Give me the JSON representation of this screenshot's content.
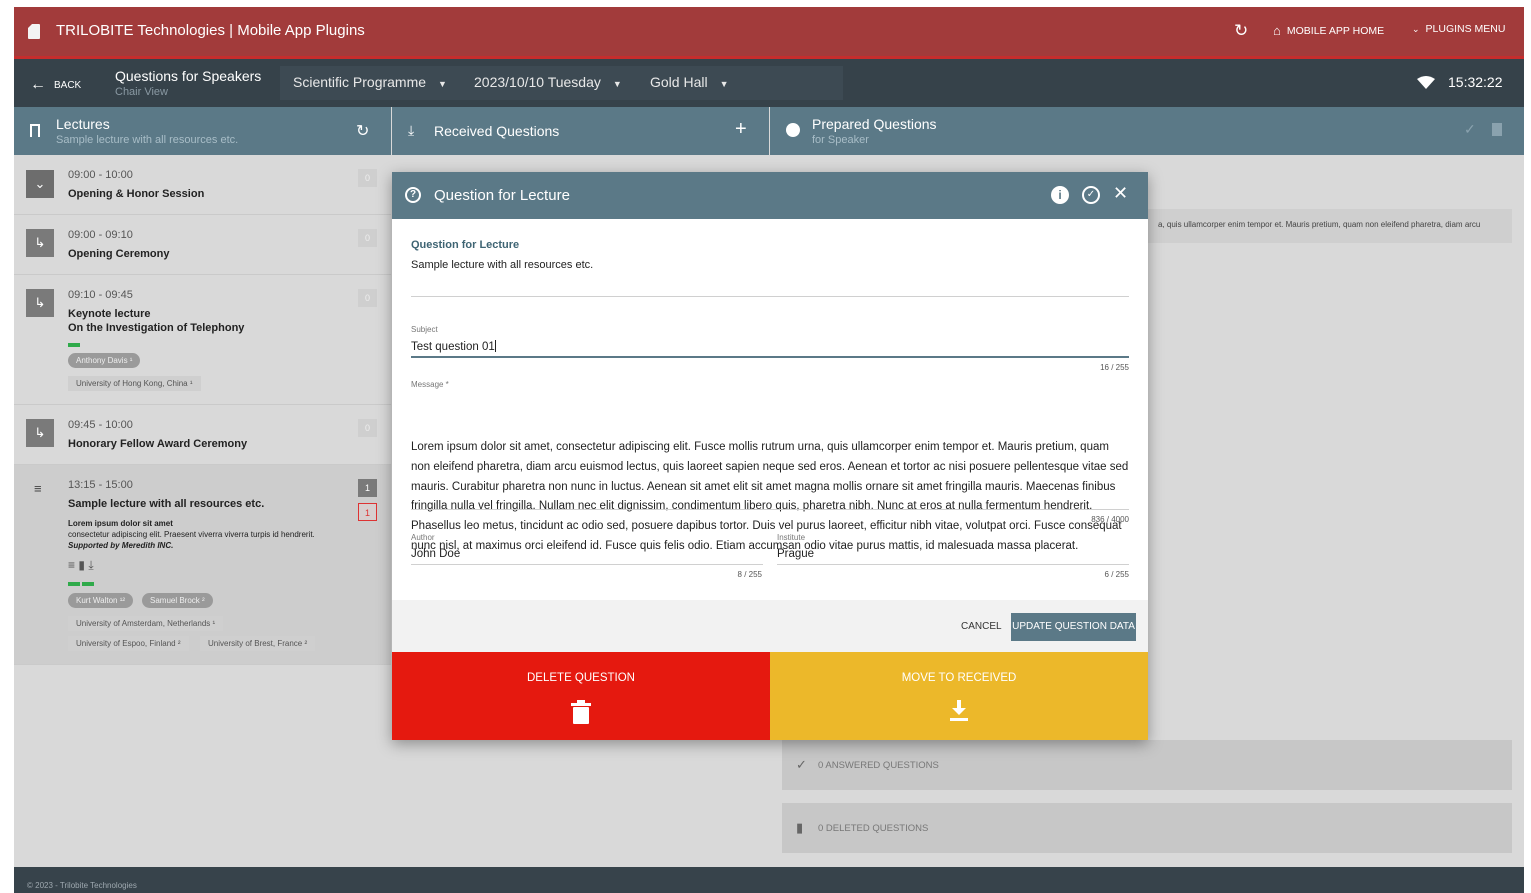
{
  "topbar": {
    "title": "TRILOBITE Technologies | Mobile App Plugins",
    "home": "MOBILE APP HOME",
    "plugins": "PLUGINS MENU"
  },
  "navbar": {
    "back": "BACK",
    "title": "Questions for Speakers",
    "subtitle": "Chair View",
    "programme": "Scientific Programme",
    "date": "2023/10/10 Tuesday",
    "hall": "Gold Hall",
    "time": "15:32:22"
  },
  "colA": {
    "title": "Lectures",
    "subtitle": "Sample lecture with all resources etc."
  },
  "colB": {
    "title": "Received Questions"
  },
  "colC": {
    "title": "Prepared Questions",
    "subtitle": "for Speaker",
    "snippet": "a, quis ullamcorper enim tempor et. Mauris pretium, quam non eleifend pharetra, diam arcu"
  },
  "lectures": [
    {
      "time": "09:00 - 10:00",
      "name": "Opening & Honor Session",
      "count": "0"
    },
    {
      "time": "09:00 - 09:10",
      "name": "Opening Ceremony",
      "count": "0"
    },
    {
      "time": "09:10 - 09:45",
      "name": "Keynote lecture",
      "name2": "On the Investigation of Telephony",
      "count": "0",
      "chip": "Anthony Davis ¹",
      "tag": "University of Hong Kong, China ¹"
    },
    {
      "time": "09:45 - 10:00",
      "name": "Honorary Fellow Award Ceremony",
      "count": "0"
    },
    {
      "time": "13:15 - 15:00",
      "name": "Sample lecture with all resources etc.",
      "count": "1",
      "count2": "1",
      "abstract1": "Lorem ipsum dolor sit amet",
      "abstract2": "consectetur adipiscing elit. Praesent viverra viverra turpis id hendrerit.",
      "abstract3": "Supported by Meredith INC.",
      "chips": [
        "Kurt Walton ¹²",
        "Samuel Brock ²"
      ],
      "tags": [
        "University of Amsterdam, Netherlands ¹",
        "University of Espoo, Finland ²",
        "University of Brest, France ²"
      ]
    }
  ],
  "answered": "0 ANSWERED QUESTIONS",
  "deleted": "0 DELETED QUESTIONS",
  "footer": "© 2023 - Trilobite Technologies",
  "modal": {
    "title": "Question for Lecture",
    "section_title": "Question for Lecture",
    "section_sub": "Sample lecture with all resources etc.",
    "subject_label": "Subject",
    "subject_value": "Test question 01",
    "subject_count": "16 / 255",
    "message_label": "Message *",
    "message_value": "Lorem ipsum dolor sit amet, consectetur adipiscing elit. Fusce mollis rutrum urna, quis ullamcorper enim tempor et. Mauris pretium, quam non eleifend pharetra, diam arcu euismod lectus, quis laoreet sapien neque sed eros. Aenean et tortor ac nisi posuere pellentesque vitae sed mauris. Curabitur pharetra non nunc in luctus. Aenean sit amet elit sit amet magna mollis ornare sit amet fringilla mauris. Maecenas finibus fringilla nulla vel fringilla. Nullam nec elit dignissim, condimentum libero quis, pharetra nibh. Nunc at eros at nulla fermentum hendrerit. Phasellus leo metus, tincidunt ac odio sed, posuere dapibus tortor. Duis vel purus laoreet, efficitur nibh vitae, volutpat orci. Fusce consequat nunc nisl, at maximus orci eleifend id. Fusce quis felis odio. Etiam accumsan odio vitae purus mattis, id malesuada massa placerat.",
    "message_count": "836 / 4000",
    "author_label": "Author",
    "author_value": "John Doe",
    "author_count": "8 / 255",
    "institute_label": "Institute",
    "institute_value": "Prague",
    "institute_count": "6 / 255",
    "cancel": "CANCEL",
    "update": "UPDATE QUESTION DATA",
    "delete": "DELETE QUESTION",
    "move": "MOVE TO RECEIVED"
  }
}
